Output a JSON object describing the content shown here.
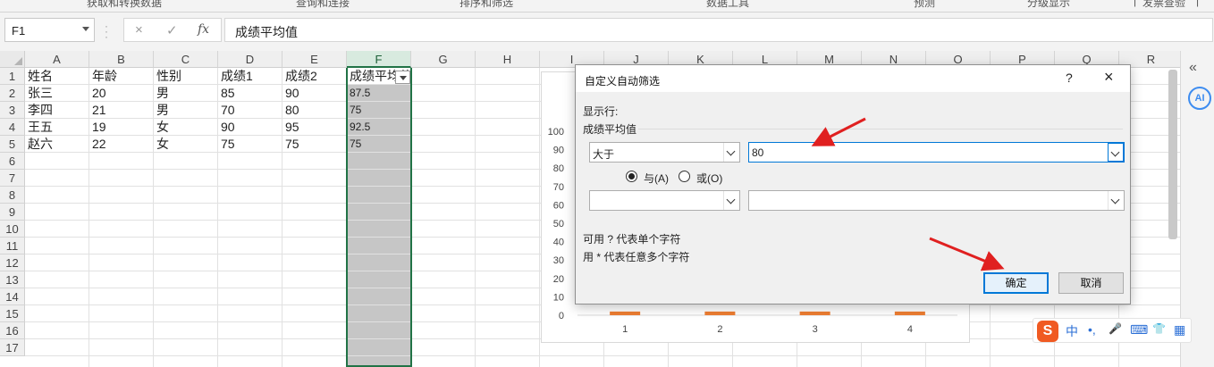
{
  "ribbon_fragments": [
    "获取和转换数据",
    "查询和连接",
    "排序和筛选",
    "数据工具",
    "预测",
    "分级显示",
    "|",
    "发票查验",
    "|"
  ],
  "formula_bar": {
    "name_box": "F1",
    "cancel_icon": "×",
    "enter_icon": "✓",
    "fx_label": "fx",
    "content": "成绩平均值"
  },
  "sheet": {
    "columns": [
      "A",
      "B",
      "C",
      "D",
      "E",
      "F",
      "G",
      "H",
      "I",
      "J",
      "K",
      "L",
      "M",
      "N",
      "O",
      "P",
      "Q",
      "R"
    ],
    "rows": [
      "1",
      "2",
      "3",
      "4",
      "5",
      "6",
      "7",
      "8",
      "9",
      "10",
      "11",
      "12",
      "13",
      "14",
      "15",
      "16",
      "17"
    ],
    "headers": [
      "姓名",
      "年龄",
      "性别",
      "成绩1",
      "成绩2",
      "成绩平均值"
    ],
    "data": [
      [
        "张三",
        "20",
        "男",
        "85",
        "90",
        "87.5"
      ],
      [
        "李四",
        "21",
        "男",
        "70",
        "80",
        "75"
      ],
      [
        "王五",
        "19",
        "女",
        "90",
        "95",
        "92.5"
      ],
      [
        "赵六",
        "22",
        "女",
        "75",
        "75",
        "75"
      ]
    ]
  },
  "chart_data": {
    "type": "bar",
    "categories": [
      "1",
      "2",
      "3",
      "4"
    ],
    "values": [
      2,
      2,
      2,
      2
    ],
    "ylim": [
      0,
      100
    ],
    "y_ticks": [
      "0",
      "10",
      "20",
      "30",
      "40",
      "50",
      "60",
      "70",
      "80",
      "90",
      "100"
    ],
    "color": "#ed7d31"
  },
  "dialog": {
    "title": "自定义自动筛选",
    "help": "?",
    "close": "×",
    "show_rows_label": "显示行:",
    "field_label": "成绩平均值",
    "condition1_operator": "大于",
    "condition1_value": "80",
    "and_label": "与(A)",
    "or_label": "或(O)",
    "condition2_operator": "",
    "condition2_value": "",
    "hint1": "可用 ? 代表单个字符",
    "hint2": "用 * 代表任意多个字符",
    "ok_button": "确定",
    "cancel_button": "取消"
  },
  "right_pane": {
    "collapse_icon": "«",
    "ai_label": "AI"
  },
  "ime_bar": {
    "logo": "S",
    "mode": "中",
    "punct": "•,",
    "mic": "🎤",
    "keyboard": "⌨",
    "skin": "👕",
    "grid": "▦"
  },
  "colors": {
    "accent": "#217346",
    "dialog_focus": "#0078d7",
    "annotation_arrow": "#e02020",
    "bar": "#ed7d31"
  }
}
